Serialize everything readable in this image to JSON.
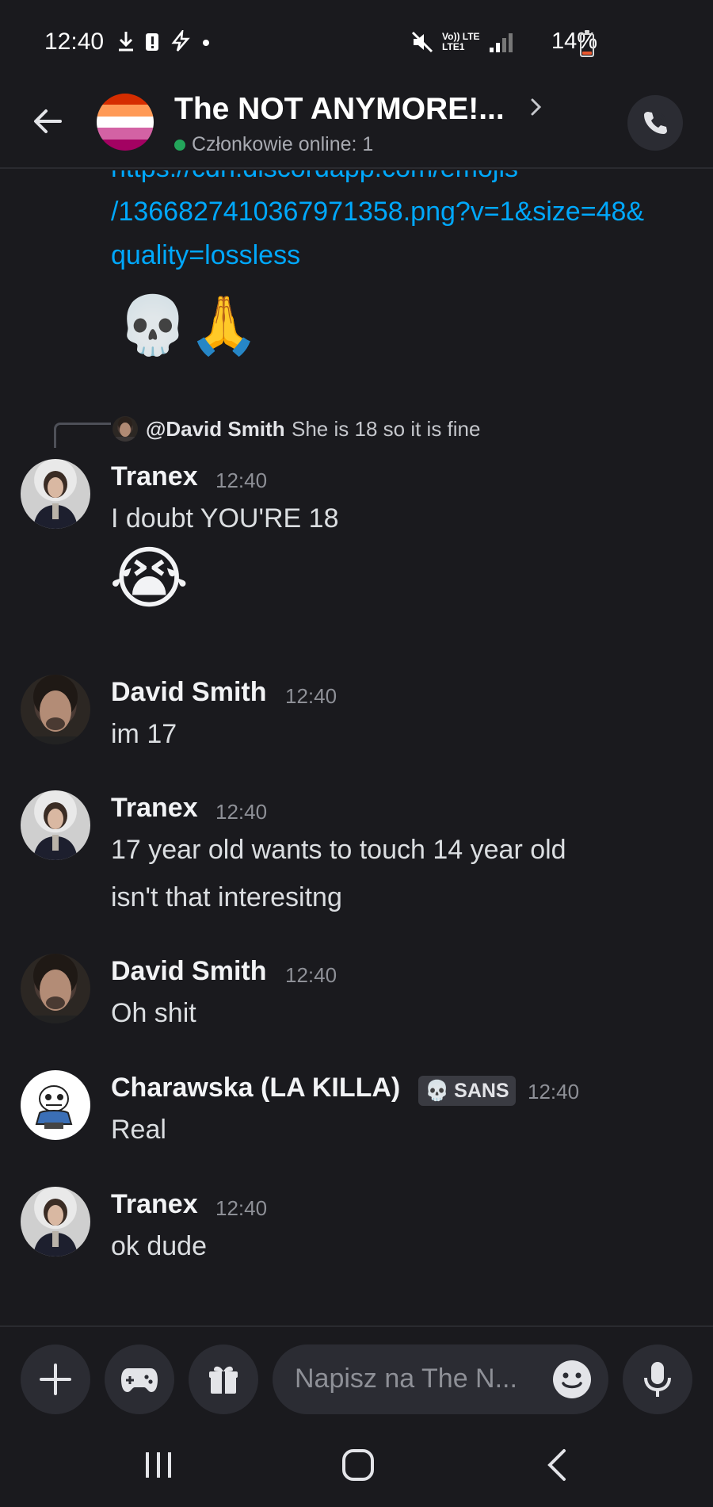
{
  "status_bar": {
    "time": "12:40",
    "network_top": "Vo)) LTE",
    "network_bottom": "LTE1",
    "battery": "14%",
    "battery_level": 0.14,
    "battery_color": "#e8572f"
  },
  "header": {
    "title": "The NOT ANYMORE!...",
    "subtitle": "Członkowie online: 1",
    "server_flag_colors": [
      "#d52d00",
      "#ff9a56",
      "#ffffff",
      "#d362a4",
      "#a30262"
    ],
    "online_color": "#23a55a"
  },
  "messages": {
    "link_lines": [
      "https://cdn.discordapp.com/emojis",
      "/1366827410367971358.png?v=1&size=48&",
      "quality=lossless"
    ],
    "link_emoji": "💀🙏",
    "reply": {
      "author": "@David Smith",
      "text": "She is 18 so it is fine"
    },
    "items": [
      {
        "author": "Tranex",
        "time": "12:40",
        "text": "I doubt YOU'RE 18",
        "emoji": "😭"
      },
      {
        "author": "David Smith",
        "time": "12:40",
        "text": "im 17"
      },
      {
        "author": "Tranex",
        "time": "12:40",
        "lines": [
          "17 year old wants to touch 14 year old",
          "isn't that interesitng"
        ]
      },
      {
        "author": "David Smith",
        "time": "12:40",
        "text": "Oh shit"
      },
      {
        "author": "Charawska (LA KILLA)",
        "tag": "SANS",
        "tag_icon": "💀",
        "time": "12:40",
        "text": "Real"
      },
      {
        "author": "Tranex",
        "time": "12:40",
        "text": "ok dude"
      }
    ]
  },
  "input": {
    "placeholder": "Napisz na The N..."
  },
  "colors": {
    "background": "#1a1a1e",
    "link": "#00a8fc",
    "surface": "#2b2c33"
  }
}
